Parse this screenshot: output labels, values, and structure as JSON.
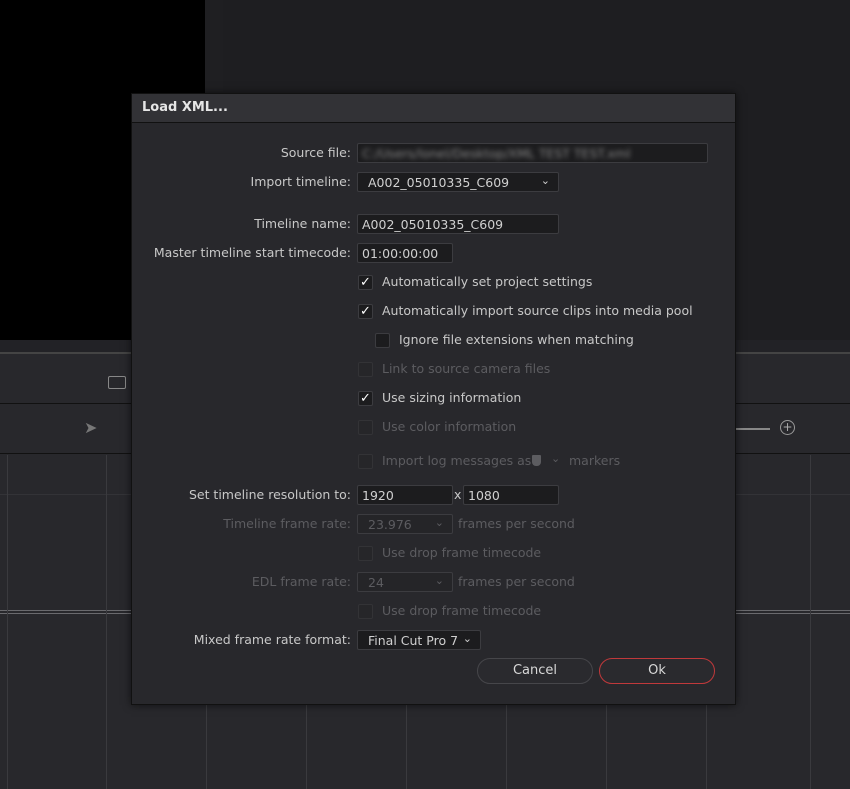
{
  "dialog": {
    "title": "Load XML...",
    "source_file": {
      "label": "Source file:",
      "value": "C:/Users/lonel/Desktop/XML TEST TEST.xml"
    },
    "import_timeline": {
      "label": "Import timeline:",
      "value": "A002_05010335_C609"
    },
    "timeline_name": {
      "label": "Timeline name:",
      "value": "A002_05010335_C609"
    },
    "start_timecode": {
      "label": "Master timeline start timecode:",
      "value": "01:00:00:00"
    },
    "checkboxes": [
      {
        "label": "Automatically set project settings",
        "checked": true,
        "enabled": true
      },
      {
        "label": "Automatically import source clips into media pool",
        "checked": true,
        "enabled": true
      },
      {
        "label": "Ignore file extensions when matching",
        "checked": false,
        "enabled": true
      },
      {
        "label": "Link to source camera files",
        "checked": false,
        "enabled": false
      },
      {
        "label": "Use sizing information",
        "checked": true,
        "enabled": true
      },
      {
        "label": "Use color information",
        "checked": false,
        "enabled": false
      }
    ],
    "log_messages": {
      "prefix": "Import log messages as",
      "suffix": "markers",
      "checked": false
    },
    "resolution": {
      "label": "Set timeline resolution to:",
      "width": "1920",
      "separator": "x",
      "height": "1080"
    },
    "timeline_frame_rate": {
      "label": "Timeline frame rate:",
      "value": "23.976",
      "unit": "frames per second"
    },
    "drop_frame_1": {
      "label": "Use drop frame timecode",
      "checked": false
    },
    "edl_frame_rate": {
      "label": "EDL frame rate:",
      "value": "24",
      "unit": "frames per second"
    },
    "drop_frame_2": {
      "label": "Use drop frame timecode",
      "checked": false
    },
    "mixed_format": {
      "label": "Mixed frame rate format:",
      "value": "Final Cut Pro 7"
    },
    "cancel_label": "Cancel",
    "ok_label": "Ok",
    "check_glyph": "✓",
    "chevron": "⌄"
  },
  "colors": {
    "accent": "#c0393b"
  }
}
